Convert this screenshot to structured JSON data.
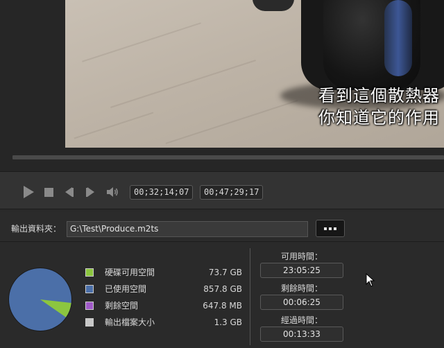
{
  "video": {
    "subtitle_line_1": "看到這個散熱器",
    "subtitle_line_2": "你知道它的作用"
  },
  "playback": {
    "current_timecode": "00;32;14;07",
    "total_timecode": "00;47;29;17"
  },
  "output": {
    "label": "輸出資料夾：",
    "path": "G:\\Test\\Produce.m2ts",
    "browse_label": "..."
  },
  "disk_usage": {
    "items": [
      {
        "label": "硬碟可用空間",
        "value": "73.7  GB",
        "color": "#8cc63f"
      },
      {
        "label": "已使用空間",
        "value": "857.8  GB",
        "color": "#4b6fa8"
      },
      {
        "label": "剩餘空間",
        "value": "647.8  MB",
        "color": "#a05ac8"
      },
      {
        "label": "輸出檔案大小",
        "value": "1.3  GB",
        "color": "#c8c8c8"
      }
    ],
    "pie_fractions": {
      "free": 0.079,
      "used": 0.921
    }
  },
  "times": {
    "available_label": "可用時間：",
    "available_value": "23:05:25",
    "remaining_label": "剩餘時間：",
    "remaining_value": "00:06:25",
    "elapsed_label": "經過時間：",
    "elapsed_value": "00:13:33"
  },
  "icons": {
    "play": "play-icon",
    "stop": "stop-icon",
    "prev_frame": "previous-frame-icon",
    "next_frame": "next-frame-icon",
    "volume": "volume-icon"
  }
}
